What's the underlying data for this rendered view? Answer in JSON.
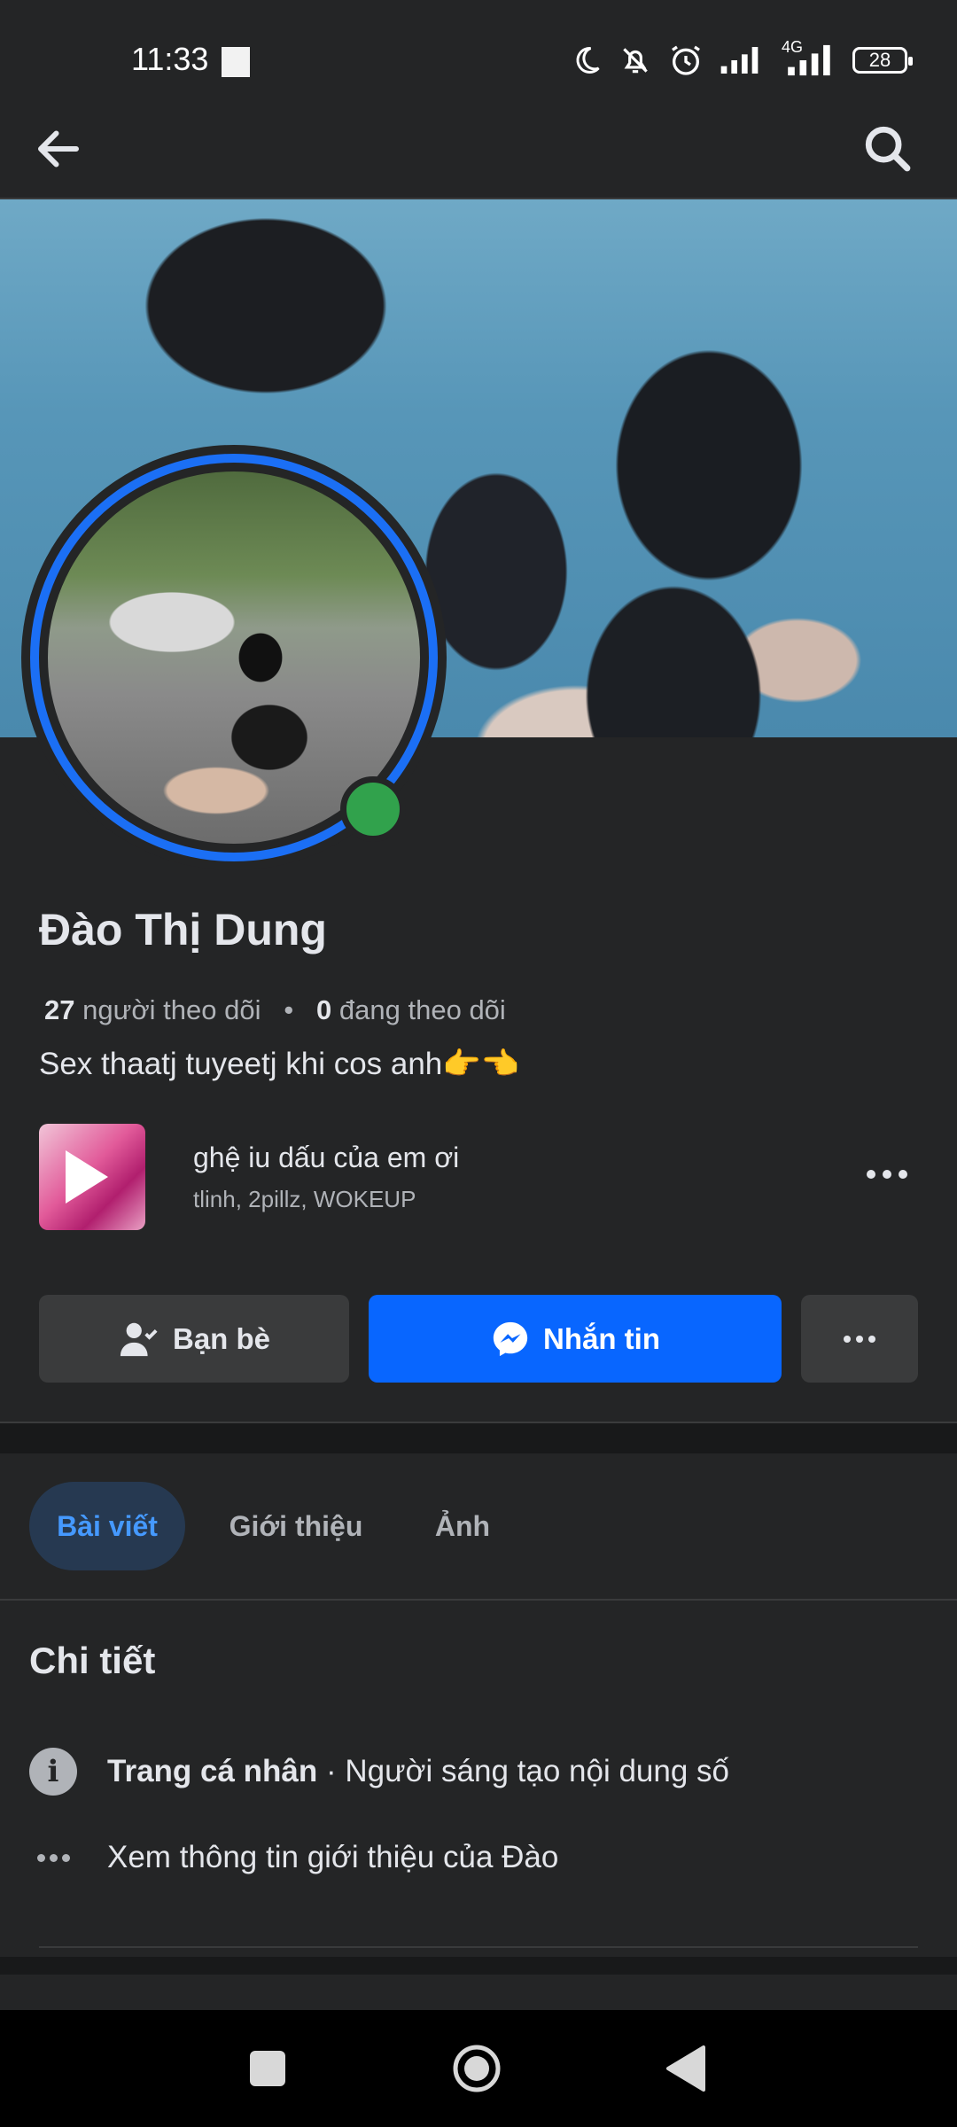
{
  "status_bar": {
    "time": "11:33",
    "network": "4G",
    "battery": "28",
    "icons": [
      "moon-icon",
      "bell-off-icon",
      "alarm-icon",
      "signal-icon",
      "signal-4g-icon",
      "battery-icon"
    ]
  },
  "header": {
    "icons": [
      "back-arrow-icon",
      "search-icon"
    ]
  },
  "profile": {
    "name": "Đào Thị Dung",
    "followers_count": "27",
    "followers_label": "người theo dõi",
    "separator": "•",
    "following_count": "0",
    "following_label": "đang theo dõi",
    "bio": "Sex thaatj tuyeetj khi cos anh👉👈"
  },
  "music": {
    "title": "ghệ iu dấu của em ơi",
    "artist": "tlinh, 2pillz, WOKEUP"
  },
  "actions": {
    "friends_label": "Bạn bè",
    "message_label": "Nhắn tin",
    "colors": {
      "primary": "#0866ff",
      "secondary": "#3a3b3c"
    }
  },
  "tabs": [
    {
      "label": "Bài viết",
      "active": true
    },
    {
      "label": "Giới thiệu",
      "active": false
    },
    {
      "label": "Ảnh",
      "active": false
    }
  ],
  "details": {
    "title": "Chi tiết",
    "page_type_label": "Trang cá nhân",
    "page_type_value": " · Người sáng tạo nội dung số",
    "see_about": "Xem thông tin giới thiệu của Đào"
  },
  "colors": {
    "background": "#242526",
    "accent": "#1b6ff5",
    "online": "#31a24c",
    "text": "#e4e6eb",
    "muted": "#b0b3b8"
  }
}
